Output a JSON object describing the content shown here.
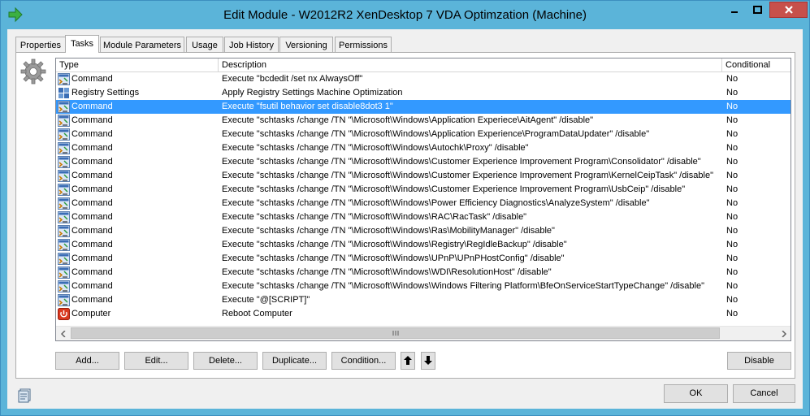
{
  "window": {
    "title": "Edit Module - W2012R2 XenDesktop 7 VDA Optimzation (Machine)"
  },
  "tabs": [
    {
      "label": "Properties"
    },
    {
      "label": "Tasks"
    },
    {
      "label": "Module Parameters"
    },
    {
      "label": "Usage"
    },
    {
      "label": "Job History"
    },
    {
      "label": "Versioning"
    },
    {
      "label": "Permissions"
    }
  ],
  "active_tab": "Tasks",
  "table": {
    "columns": [
      "Type",
      "Description",
      "Conditional"
    ],
    "rows": [
      {
        "icon": "command-icon",
        "type": "Command",
        "description": "Execute \"bcdedit /set nx AlwaysOff\"",
        "conditional": "No"
      },
      {
        "icon": "registry-settings-icon",
        "type": "Registry Settings",
        "description": "Apply Registry Settings Machine Optimization",
        "conditional": "No"
      },
      {
        "icon": "command-icon",
        "type": "Command",
        "description": "Execute \"fsutil behavior set disable8dot3 1\"",
        "conditional": "No",
        "selected": true
      },
      {
        "icon": "command-icon",
        "type": "Command",
        "description": "Execute \"schtasks /change /TN \"\\Microsoft\\Windows\\Application Experiece\\AitAgent\" /disable\"",
        "conditional": "No"
      },
      {
        "icon": "command-icon",
        "type": "Command",
        "description": "Execute \"schtasks /change /TN \"\\Microsoft\\Windows\\Application Experience\\ProgramDataUpdater\" /disable\"",
        "conditional": "No"
      },
      {
        "icon": "command-icon",
        "type": "Command",
        "description": "Execute \"schtasks /change /TN \"\\Microsoft\\Windows\\Autochk\\Proxy\" /disable\"",
        "conditional": "No"
      },
      {
        "icon": "command-icon",
        "type": "Command",
        "description": "Execute \"schtasks /change /TN \"\\Microsoft\\Windows\\Customer Experience Improvement Program\\Consolidator\" /disable\"",
        "conditional": "No"
      },
      {
        "icon": "command-icon",
        "type": "Command",
        "description": "Execute \"schtasks /change /TN \"\\Microsoft\\Windows\\Customer Experience Improvement Program\\KernelCeipTask\" /disable\"",
        "conditional": "No"
      },
      {
        "icon": "command-icon",
        "type": "Command",
        "description": "Execute \"schtasks /change /TN \"\\Microsoft\\Windows\\Customer Experience Improvement Program\\UsbCeip\" /disable\"",
        "conditional": "No"
      },
      {
        "icon": "command-icon",
        "type": "Command",
        "description": "Execute \"schtasks /change /TN \"\\Microsoft\\Windows\\Power Efficiency Diagnostics\\AnalyzeSystem\" /disable\"",
        "conditional": "No"
      },
      {
        "icon": "command-icon",
        "type": "Command",
        "description": "Execute \"schtasks /change /TN \"\\Microsoft\\Windows\\RAC\\RacTask\" /disable\"",
        "conditional": "No"
      },
      {
        "icon": "command-icon",
        "type": "Command",
        "description": "Execute \"schtasks /change /TN \"\\Microsoft\\Windows\\Ras\\MobilityManager\" /disable\"",
        "conditional": "No"
      },
      {
        "icon": "command-icon",
        "type": "Command",
        "description": "Execute \"schtasks /change /TN \"\\Microsoft\\Windows\\Registry\\RegIdleBackup\" /disable\"",
        "conditional": "No"
      },
      {
        "icon": "command-icon",
        "type": "Command",
        "description": "Execute \"schtasks /change /TN \"\\Microsoft\\Windows\\UPnP\\UPnPHostConfig\" /disable\"",
        "conditional": "No"
      },
      {
        "icon": "command-icon",
        "type": "Command",
        "description": "Execute \"schtasks /change /TN \"\\Microsoft\\Windows\\WDI\\ResolutionHost\" /disable\"",
        "conditional": "No"
      },
      {
        "icon": "command-icon",
        "type": "Command",
        "description": "Execute \"schtasks /change /TN \"\\Microsoft\\Windows\\Windows Filtering Platform\\BfeOnServiceStartTypeChange\" /disable\"",
        "conditional": "No"
      },
      {
        "icon": "command-icon",
        "type": "Command",
        "description": "Execute \"@[SCRIPT]\"",
        "conditional": "No"
      },
      {
        "icon": "reboot-computer-icon",
        "type": "Computer",
        "description": "Reboot Computer",
        "conditional": "No"
      }
    ]
  },
  "buttons": {
    "add": "Add...",
    "edit": "Edit...",
    "delete": "Delete...",
    "duplicate": "Duplicate...",
    "condition": "Condition...",
    "disable": "Disable",
    "ok": "OK",
    "cancel": "Cancel"
  },
  "colors": {
    "title_bar": "#5bb4d9",
    "selection": "#3399ff",
    "close_button": "#c7504b"
  }
}
